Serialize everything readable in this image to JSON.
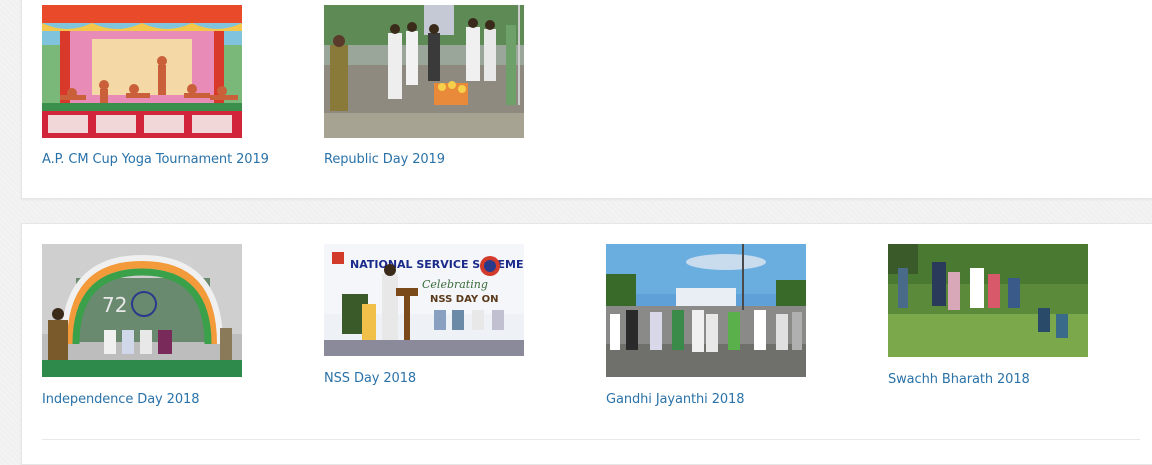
{
  "galleries": [
    {
      "items": [
        {
          "title": "A.P. CM Cup Yoga Tournament 2019",
          "image_alt": "Yoga performance on decorated stage"
        },
        {
          "title": "Republic Day 2019",
          "image_alt": "Flag hoisting ceremony"
        }
      ]
    },
    {
      "items": [
        {
          "title": "Independence Day 2018",
          "image_alt": "Speaker at podium with tricolour balloon arch"
        },
        {
          "title": "NSS Day 2018",
          "image_alt": "NSS Day celebration on stage",
          "banner_line1": "NATIONAL SERVICE SCHEME",
          "banner_line2": "Celebrating",
          "banner_line3": "NSS DAY ON"
        },
        {
          "title": "Gandhi Jayanthi 2018",
          "image_alt": "Group walking on campus road"
        },
        {
          "title": "Swachh Bharath 2018",
          "image_alt": "Volunteers clearing vegetation"
        }
      ]
    }
  ],
  "colors": {
    "link": "#2a72a8",
    "panel_bg": "#ffffff",
    "page_bg": "#f3f3f3"
  }
}
